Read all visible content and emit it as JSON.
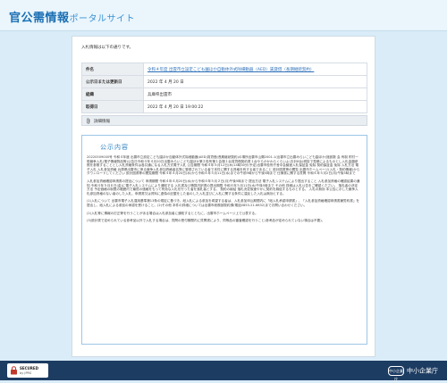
{
  "header": {
    "logo_main": "官公需情報",
    "logo_sub": "ポータルサイト"
  },
  "intro": "入札情報は以下の通りです。",
  "info_rows": [
    {
      "key": "件名",
      "value": "令和４年度 出雲市立設定こども園ほか自動体外式除細動器（AED）賃貸借（長期継続契約）",
      "link": true
    },
    {
      "key": "公示日または更新日",
      "value": "2022 年 4 月 20 日",
      "link": false
    },
    {
      "key": "組織",
      "value": "兵庫県出雲市",
      "link": false
    },
    {
      "key": "取得日",
      "value": "2022 年 4 月 20 日 19:00:22",
      "link": false
    }
  ],
  "attachment_label": "詳細情報",
  "notice": {
    "title": "公示内容",
    "paragraphs": [
      "20220509000号 令和４年度 出雲市立設定こども園ほか自動体外式除細動器(AED)賃貸借(長期継続契約)の場所出雲市山陽2001-1(出雲市立出雲みらいこども園ほか)施設数 会 有制 附付一般競争入札(電子情報物品等)公告日令和４年４月20日出雲みらいこども園ほか第２役所第１会場１台賃貸借契約書１台やらかかわらくらいよ(お計8台)税抜で見積によるものとし入札金額参照を参照することとし入札資格条件は各共通になる入札方式電子入札 公告期間 令和４年５月12日(木)14時30分(予定)出雲市役所庁舎中会議室入札保証金 免除 契約保証金 免除 入札方法 電子入札 入札参加資格 兵庫県出雲市に係る競争入札参加資格者名簿に登録されている者で本件に関する資格を有する者であること 設計図書等の閲覧 出雲市ホームページ(入札・契約情報)からダウンロードしてください 設計図書等の閲覧期間 令和４年４月20日(水)から令和４年５月11日(水)までの午前9時から午後5時まで 仕様書に関する質問 令和４年５月2日(月)午後5時まで",
      "入札参加資格確認申請書の提出について 申請期間 令和４年４月20日(水)から令和４年５月２日(月)午後5時まで 提出方法 電子入札システムにより提出すること 入札参加資格の確認結果の通知 令和４年５月６日(金)に電子入札システムにより通知する 入札書及び積算内訳書の提出期限 令和４年５月11日(水)午後5時まで その他 詳細は入札公告をご確認ください。 落札者の決定方法 予定価格の制限の範囲内で最低の価格をもって有効な入札を行った者を落札者とする。 契約の締結 落札決定後速やかに契約を締結するものとする。 入札の無効 本公告に示した競争入札参加資格のない者のした入札、申請書又は資料に虚偽の記載をした者のした入札並びに入札に関する条件に違反した入札は無効とする。",
      "(1)入札について 出雲市電子入札運用基準第13条の規定に基づき、紙入札による参加を希望する者は、入札参加申込期間内に「紙入札承認申請書」、「入札参加資格確認申請書兼誓約書」を提出し、紙入札による参加の承認を受けること。(2)その他 本件の詳細については出雲市総務部契約課(電話0853-21-6632)までお問い合わせください。",
      "(2)入札等に情報の訂正等を行うことがある場合は入札参加者に通知するとともに、出雲市ホームページ上で公表する。",
      "(3)設計書で定められている参考品以外で入札する場合は、質問の受付期間内に質問書により、同等品の審査確認を行うこと(参考品が定められていない場合は不要)。"
    ]
  },
  "footer": {
    "secured_title": "SECURED",
    "secured_sub": "by JPRS",
    "emblem": "中小企業庁",
    "org_name": "中小企業庁"
  },
  "colors": {
    "brand": "#1b6fb3",
    "footer_bg": "#1d3c62",
    "notice_border": "#9cc7e6"
  }
}
